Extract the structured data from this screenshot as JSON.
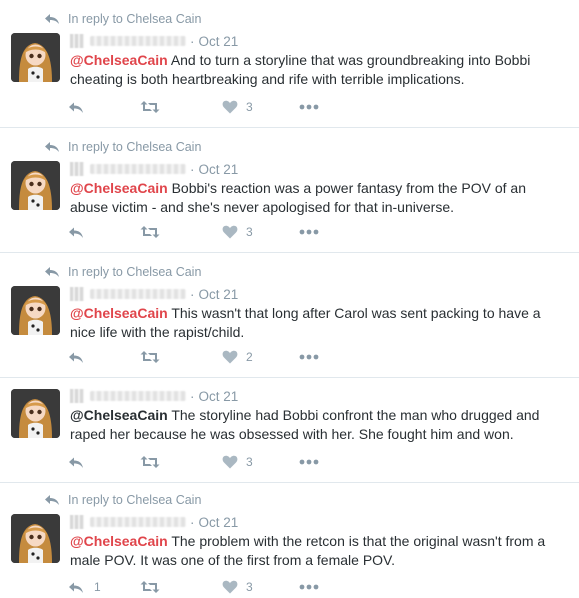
{
  "colors": {
    "accent_mention": "#e0454b",
    "text": "#292f33",
    "meta": "#8899a6",
    "divider": "#e1e8ed"
  },
  "icons": {
    "context": "reply-arrow-icon",
    "reply": "reply-icon",
    "retweet": "retweet-icon",
    "like": "heart-icon",
    "more": "more-dots-icon"
  },
  "tweets": [
    {
      "context": "In reply to Chelsea Cain",
      "time": "Oct 21",
      "mention": "@ChelseaCain",
      "body": "And to turn a storyline that was groundbreaking into Bobbi cheating is both heartbreaking and rife with terrible implications.",
      "reply_count": "",
      "like_count": "3"
    },
    {
      "context": "In reply to Chelsea Cain",
      "time": "Oct 21",
      "mention": "@ChelseaCain",
      "body": "Bobbi's reaction was a power fantasy from the POV of an abuse victim - and she's never apologised for that in-universe.",
      "reply_count": "",
      "like_count": "3"
    },
    {
      "context": "In reply to Chelsea Cain",
      "time": "Oct 21",
      "mention": "@ChelseaCain",
      "body": "This wasn't that long after Carol was sent packing to have a nice life with the rapist/child.",
      "reply_count": "",
      "like_count": "2"
    },
    {
      "context": "",
      "time": "Oct 21",
      "mention": "@ChelseaCain",
      "body": "The storyline had Bobbi confront the man who drugged and raped her because he was obsessed with her. She fought him and won.",
      "reply_count": "",
      "like_count": "3"
    },
    {
      "context": "In reply to Chelsea Cain",
      "time": "Oct 21",
      "mention": "@ChelseaCain",
      "body": "The problem with the retcon is that the original wasn't from a male POV. It was one of the first from a female POV.",
      "reply_count": "1",
      "like_count": "3"
    }
  ]
}
